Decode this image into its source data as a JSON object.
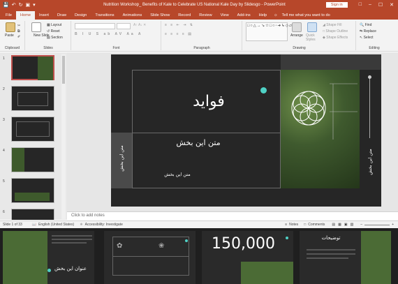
{
  "app": {
    "title": "Nutrition Workshop_ Benefits of Kale to Celebrate US National Kale Day by Slidesgo  -  PowerPoint",
    "sign_in": "Sign in",
    "colors": {
      "accent": "#b7472a",
      "slide_bg": "#262626",
      "teal": "#4fd1c5"
    }
  },
  "tabs": [
    "File",
    "Home",
    "Insert",
    "Draw",
    "Design",
    "Transitions",
    "Animations",
    "Slide Show",
    "Record",
    "Review",
    "View",
    "Add-ins",
    "Help"
  ],
  "active_tab": "Home",
  "tell_me": "Tell me what you want to do",
  "ribbon": {
    "clipboard": {
      "label": "Clipboard",
      "paste": "Paste"
    },
    "slides": {
      "label": "Slides",
      "new_slide": "New Slide",
      "layout": "Layout",
      "reset": "Reset",
      "section": "Section"
    },
    "font": {
      "label": "Font"
    },
    "paragraph": {
      "label": "Paragraph"
    },
    "drawing": {
      "label": "Drawing",
      "arrange": "Arrange",
      "quick_styles": "Quick Styles",
      "shape_fill": "Shape Fill",
      "shape_outline": "Shape Outline",
      "shape_effects": "Shape Effects"
    },
    "editing": {
      "label": "Editing",
      "find": "Find",
      "replace": "Replace",
      "select": "Select"
    }
  },
  "thumbnails": [
    "1",
    "2",
    "3",
    "4",
    "5",
    "6"
  ],
  "slide": {
    "title": "فواید",
    "subtitle": "متن این بخش",
    "body": "متن این بخش",
    "side_left": "متن این بخش",
    "side_right": "متن این بخش"
  },
  "notes_placeholder": "Click to add notes",
  "status": {
    "slide_of": "Slide 1 of 33",
    "language": "English (United States)",
    "accessibility": "Accessibility: Investigate",
    "notes": "Notes",
    "comments": "Comments"
  },
  "bottom_slides": [
    {
      "text": "عنوان این بخش"
    },
    {
      "text": ""
    },
    {
      "text": "150,000"
    },
    {
      "text": "توضیحات"
    }
  ]
}
